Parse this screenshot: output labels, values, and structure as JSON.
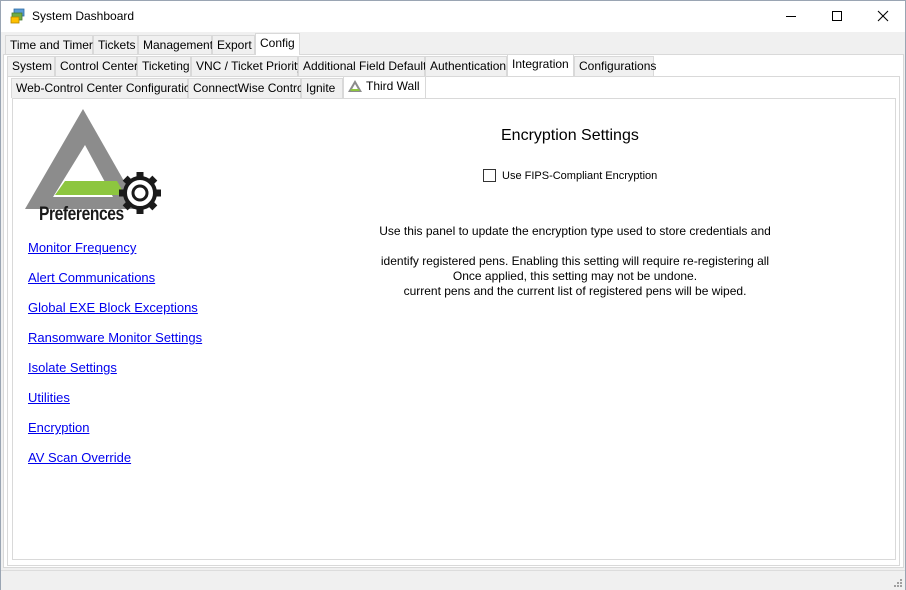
{
  "window": {
    "title": "System Dashboard"
  },
  "tabs_level1": [
    "Time and Timers",
    "Tickets",
    "Management",
    "Export",
    "Config"
  ],
  "tabs_level1_active": "Config",
  "tabs_level2": [
    "System",
    "Control Center",
    "Ticketing",
    "VNC / Ticket Priority",
    "Additional Field Defaults",
    "Authentication",
    "Integration",
    "Configurations"
  ],
  "tabs_level2_active": "Integration",
  "tabs_level3": [
    "Web-Control Center Configuration",
    "ConnectWise Control",
    "Ignite",
    "Third Wall"
  ],
  "tabs_level3_active": "Third Wall",
  "sidebar": {
    "logo_label": "Preferences",
    "links": [
      "Monitor Frequency",
      "Alert Communications",
      "Global EXE Block Exceptions",
      "Ransomware Monitor Settings",
      "Isolate Settings",
      "Utilities",
      "Encryption",
      "AV Scan Override"
    ]
  },
  "main": {
    "heading": "Encryption Settings",
    "checkbox_label": "Use FIPS-Compliant Encryption",
    "checkbox_checked": false,
    "description_line1": "Use this panel to update the encryption type used to store credentials and",
    "description_line2": "identify registered pens.  Enabling this setting will require re-registering all",
    "description_line3": "current pens and the current list of registered pens will be wiped.",
    "note": "Once applied, this setting may not be undone."
  },
  "colors": {
    "logo_gray": "#8c8c8c",
    "logo_green": "#8dc63f",
    "link_blue": "#0000ee"
  }
}
